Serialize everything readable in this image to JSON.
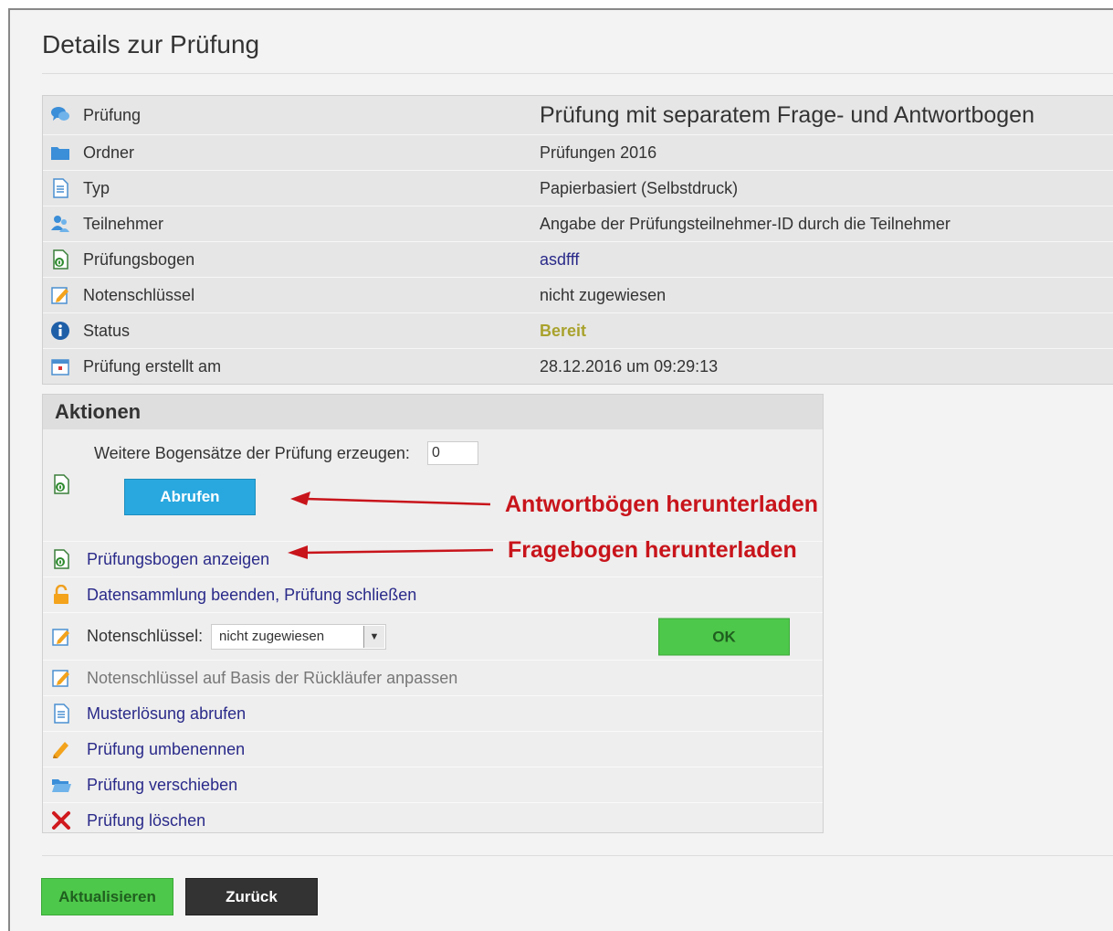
{
  "page": {
    "title": "Details zur Prüfung"
  },
  "details": [
    {
      "icon": "speech-bubbles-icon",
      "label": "Prüfung",
      "value": "Prüfung mit separatem Frage- und Antwortbogen"
    },
    {
      "icon": "folder-icon",
      "label": "Ordner",
      "value": "Prüfungen 2016"
    },
    {
      "icon": "document-icon",
      "label": "Typ",
      "value": "Papierbasiert (Selbstdruck)"
    },
    {
      "icon": "users-icon",
      "label": "Teilnehmer",
      "value": "Angabe der Prüfungsteilnehmer-ID durch die Teilnehmer"
    },
    {
      "icon": "exam-sheet-icon",
      "label": "Prüfungsbogen",
      "value": "asdfff"
    },
    {
      "icon": "edit-icon",
      "label": "Notenschlüssel",
      "value": "nicht zugewiesen"
    },
    {
      "icon": "info-icon",
      "label": "Status",
      "value": "Bereit"
    },
    {
      "icon": "calendar-icon",
      "label": "Prüfung erstellt am",
      "value": "28.12.2016 um 09:29:13"
    }
  ],
  "actions": {
    "title": "Aktionen",
    "generate_label": "Weitere Bogensätze der Prüfung erzeugen:",
    "generate_value": "0",
    "abrufen_label": "Abrufen",
    "show_sheet": "Prüfungsbogen anzeigen",
    "close_exam": "Datensammlung beenden, Prüfung schließen",
    "grading_key_label": "Notenschlüssel:",
    "grading_key_selected": "nicht zugewiesen",
    "ok_label": "OK",
    "adjust_key": "Notenschlüssel auf Basis der Rückläufer anpassen",
    "solution": "Musterlösung abrufen",
    "rename": "Prüfung umbenennen",
    "move": "Prüfung verschieben",
    "delete": "Prüfung löschen"
  },
  "annotations": {
    "answer_sheets": "Antwortbögen herunterladen",
    "question_sheets": "Fragebogen herunterladen"
  },
  "footer": {
    "update_label": "Aktualisieren",
    "back_label": "Zurück"
  },
  "colors": {
    "link": "#2a2a8a",
    "status_ready": "#a9a22d",
    "annotation_red": "#c8141b",
    "button_blue": "#29a8df",
    "button_green": "#4ec84a",
    "button_dark": "#333333"
  }
}
